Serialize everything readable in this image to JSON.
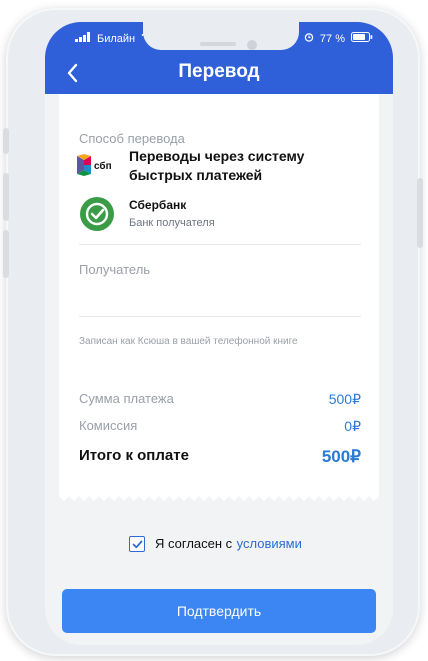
{
  "status_bar": {
    "carrier": "Билайн",
    "battery": "77 %"
  },
  "header": {
    "title": "Перевод",
    "background": "#2f5fd9"
  },
  "transfer_method": {
    "label": "Способ перевода",
    "sbp_logo_text": "сбп",
    "sbp_title": "Переводы через систему быстрых платежей"
  },
  "bank": {
    "name": "Сбербанк",
    "subtitle": "Банк получателя",
    "color": "#3a9c47"
  },
  "recipient": {
    "label": "Получатель",
    "note": "Записан как Ксюша  в вашей телефонной книге"
  },
  "summary": {
    "amount_label": "Сумма платежа",
    "amount_value": "500₽",
    "commission_label": "Комиссия",
    "commission_value": "0₽",
    "total_label": "Итого к оплате",
    "total_value": "500₽",
    "accent": "#2a7ad6"
  },
  "agreement": {
    "checked": true,
    "text": "Я согласен с",
    "link_text": "условиями"
  },
  "confirm_button": {
    "label": "Подтвердить",
    "color": "#3b86f2"
  }
}
